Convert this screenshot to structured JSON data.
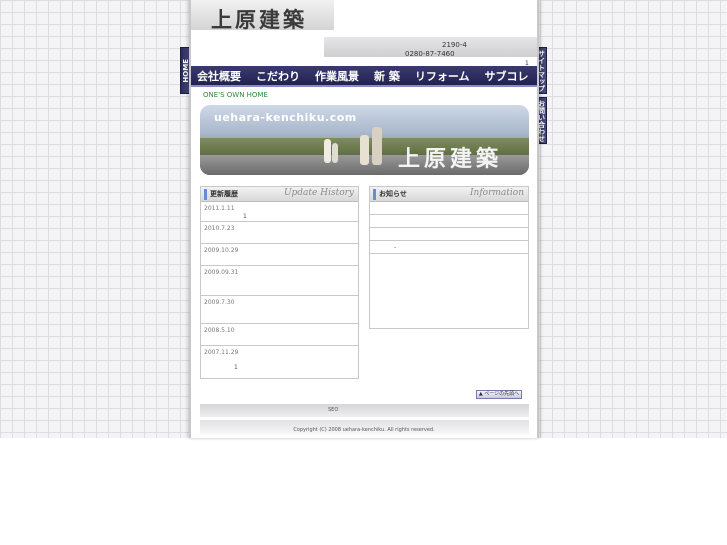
{
  "site": {
    "logo_text": "上原建築",
    "address_line": "2190-4",
    "tel": "0280-87-7460",
    "header_mark": "1",
    "tagline": "ONE'S OWN HOME"
  },
  "nav": {
    "items": [
      "会社概要",
      "こだわり",
      "作業風景",
      "新 築",
      "リフォーム",
      "サブコレ"
    ]
  },
  "side_tabs": {
    "home": "HOME",
    "sitemap": "サイトマップ",
    "contact": "お問い合わせ"
  },
  "banner": {
    "url": "uehara-kenchiku.com",
    "title": "上原建築"
  },
  "update_panel": {
    "title_ja": "更新履歴",
    "title_en": "Update History",
    "entries": [
      {
        "date": "2011.1.11",
        "note": "1"
      },
      {
        "date": "2010.7.23",
        "note": ""
      },
      {
        "date": "2009.10.29",
        "note": ""
      },
      {
        "date": "2009.09.31",
        "note": ""
      },
      {
        "date": "2009.7.30",
        "note": ""
      },
      {
        "date": "2008.5.10",
        "note": ""
      },
      {
        "date": "2007.11.29",
        "note": "1"
      }
    ]
  },
  "news_panel": {
    "title_ja": "お知らせ",
    "title_en": "Information",
    "row_note": "-"
  },
  "footer": {
    "page_top": "▲ ページの先頭へ",
    "seo_text": "SEO",
    "copyright": "Copyright (C) 2008 uehara-kenchiku. All rights reserved."
  }
}
